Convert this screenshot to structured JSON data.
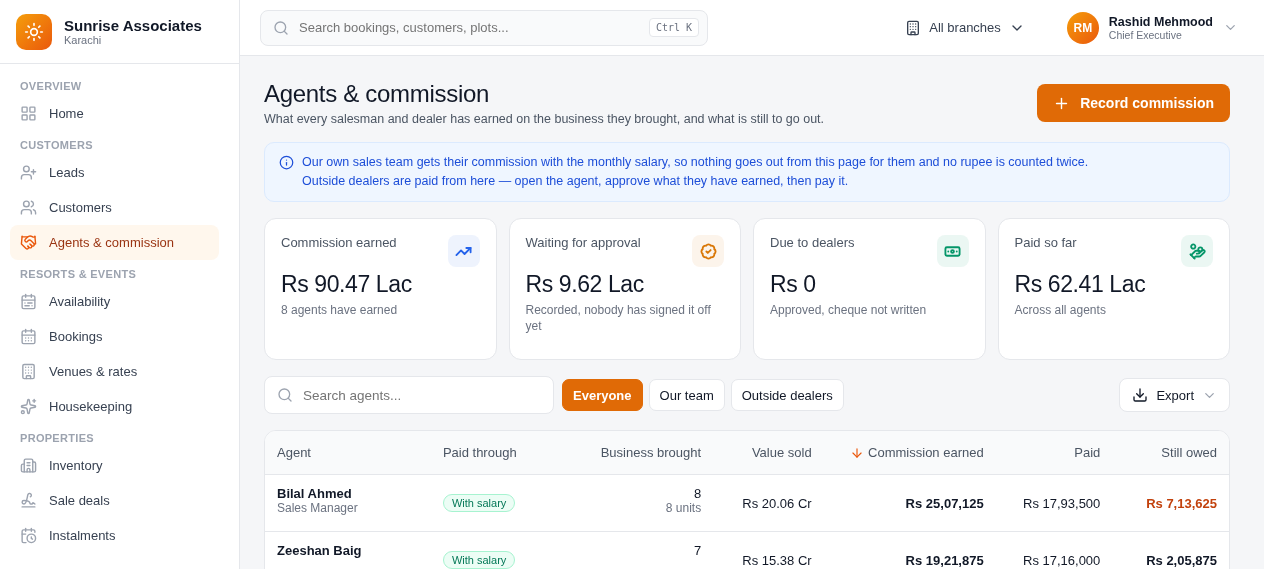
{
  "brand": {
    "name": "Sunrise Associates",
    "city": "Karachi"
  },
  "sidebar": {
    "sections": [
      {
        "title": "OVERVIEW",
        "items": [
          {
            "label": "Home",
            "selected": false
          }
        ]
      },
      {
        "title": "CUSTOMERS",
        "items": [
          {
            "label": "Leads",
            "selected": false
          },
          {
            "label": "Customers",
            "selected": false
          },
          {
            "label": "Agents & commission",
            "selected": true
          }
        ]
      },
      {
        "title": "RESORTS & EVENTS",
        "items": [
          {
            "label": "Availability",
            "selected": false
          },
          {
            "label": "Bookings",
            "selected": false
          },
          {
            "label": "Venues & rates",
            "selected": false
          },
          {
            "label": "Housekeeping",
            "selected": false
          }
        ]
      },
      {
        "title": "PROPERTIES",
        "items": [
          {
            "label": "Inventory",
            "selected": false
          },
          {
            "label": "Sale deals",
            "selected": false
          },
          {
            "label": "Instalments",
            "selected": false
          }
        ]
      }
    ]
  },
  "topbar": {
    "search": {
      "placeholder": "Search bookings, customers, plots...",
      "shortcut": "Ctrl K"
    },
    "branch": "All branches",
    "user": {
      "initials": "RM",
      "name": "Rashid Mehmood",
      "role": "Chief Executive"
    }
  },
  "page": {
    "title": "Agents & commission",
    "subtitle": "What every salesman and dealer has earned on the business they brought, and what is still to go out.",
    "action": "Record commission",
    "notice": [
      "Our own sales team gets their commission with the monthly salary, so nothing goes out from this page for them and no rupee is counted twice.",
      "Outside dealers are paid from here — open the agent, approve what they have earned, then pay it."
    ]
  },
  "stats": [
    {
      "label": "Commission earned",
      "value": "Rs 90.47 Lac",
      "note": "8 agents have earned",
      "color": "#2563eb"
    },
    {
      "label": "Waiting for approval",
      "value": "Rs 9.62 Lac",
      "note": "Recorded, nobody has signed it off yet",
      "color": "#d97706"
    },
    {
      "label": "Due to dealers",
      "value": "Rs 0",
      "note": "Approved, cheque not written",
      "color": "#059669"
    },
    {
      "label": "Paid so far",
      "value": "Rs 62.41 Lac",
      "note": "Across all agents",
      "color": "#059669"
    }
  ],
  "filters": {
    "search": {
      "placeholder": "Search agents..."
    },
    "chips": [
      {
        "label": "Everyone",
        "selected": true
      },
      {
        "label": "Our team",
        "selected": false
      },
      {
        "label": "Outside dealers",
        "selected": false
      }
    ],
    "export": "Export"
  },
  "table": {
    "columns": [
      {
        "label": "Agent",
        "sorted": false
      },
      {
        "label": "Paid through",
        "sorted": false
      },
      {
        "label": "Business brought",
        "sorted": false
      },
      {
        "label": "Value sold",
        "sorted": false
      },
      {
        "label": "Commission earned",
        "sorted": true
      },
      {
        "label": "Paid",
        "sorted": false
      },
      {
        "label": "Still owed",
        "sorted": false
      }
    ],
    "rows": [
      {
        "name": "Bilal Ahmed",
        "role": "Sales Manager",
        "paid_through": "With salary",
        "count": "8",
        "units": "8 units",
        "value": "Rs 20.06 Cr",
        "commission": "Rs 25,07,125",
        "paid": "Rs 17,93,500",
        "owed": "Rs 7,13,625",
        "owed_highlight": true
      },
      {
        "name": "Zeeshan Baig",
        "paid_through": "With salary",
        "count": "7",
        "value": "Rs 15.38 Cr",
        "commission": "Rs 19,21,875",
        "paid": "Rs 17,16,000",
        "owed": "Rs 2,05,875",
        "owed_highlight": false
      }
    ]
  }
}
